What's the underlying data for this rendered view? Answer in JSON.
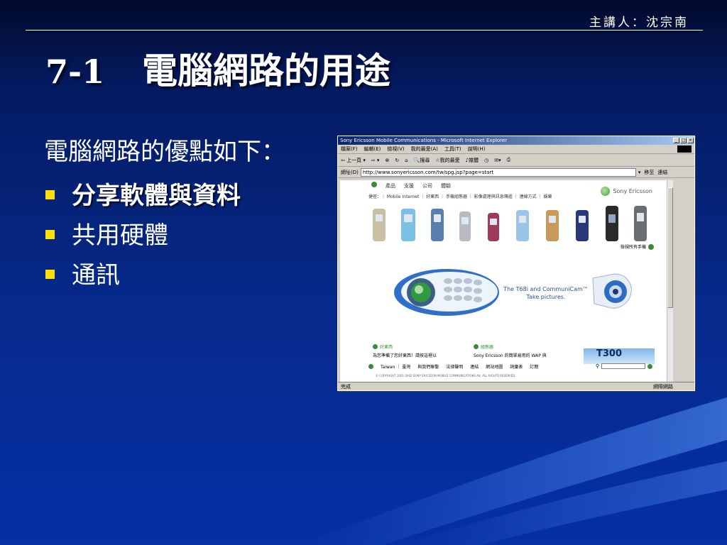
{
  "header": {
    "speaker": "主講人：沈宗南"
  },
  "title": {
    "number": "7-1",
    "text": "電腦網路的用途"
  },
  "intro": "電腦網路的優點如下：",
  "bullets": [
    {
      "label": "分享軟體與資料",
      "active": true
    },
    {
      "label": "共用硬體",
      "active": false
    },
    {
      "label": "通訊",
      "active": false
    }
  ],
  "colors": {
    "bullet": "#ffe000",
    "background": "#06298a"
  },
  "browser": {
    "window_title": "Sony Ericsson Mobile Communications - Microsoft Internet Explorer",
    "menu": [
      "檔案(F)",
      "編輯(E)",
      "檢視(V)",
      "我的最愛(A)",
      "工具(T)",
      "說明(H)"
    ],
    "toolbar": {
      "back": "上一頁",
      "search": "搜尋",
      "favorites": "我的最愛",
      "media": "媒體"
    },
    "address_label": "網址(D)",
    "address": "http://www.sonyericsson.com/tw/spg.jsp?page=start",
    "go": "移至",
    "links": "連結",
    "status_left": "完成",
    "status_right": "網際網路",
    "page": {
      "nav": [
        "產品",
        "支援",
        "公司",
        "體驗"
      ],
      "sub_nav": "捷徑：｜ Mobile Internet ｜ 好東西 ｜ 手機組態器 ｜ 影像處理與訊息傳遞 ｜ 連線方式 ｜ 娛樂",
      "brand": "Sony Ericsson",
      "more_phones": "檢視所有手機",
      "tagline_1": "The T68i and CommuniCam™",
      "tagline_2": "Take pictures.",
      "news_heading": "好東西",
      "news_body": "為您準備了您好東西！請按這裡以",
      "feature_heading": "組態器",
      "feature_body": "Sony Ericsson 的簡單易用的 WAP 與",
      "promo": "T300",
      "footer": [
        "Taiwan ｜ 臺灣",
        "與我們聯繫",
        "法律聲明",
        "連結",
        "網站地圖",
        "詞彙表",
        "訂閱"
      ],
      "copyright": "© COPYRIGHT 2001-2002 SONY ERICSSON MOBILE COMMUNICATIONS AB. ALL RIGHTS RESERVED."
    }
  }
}
